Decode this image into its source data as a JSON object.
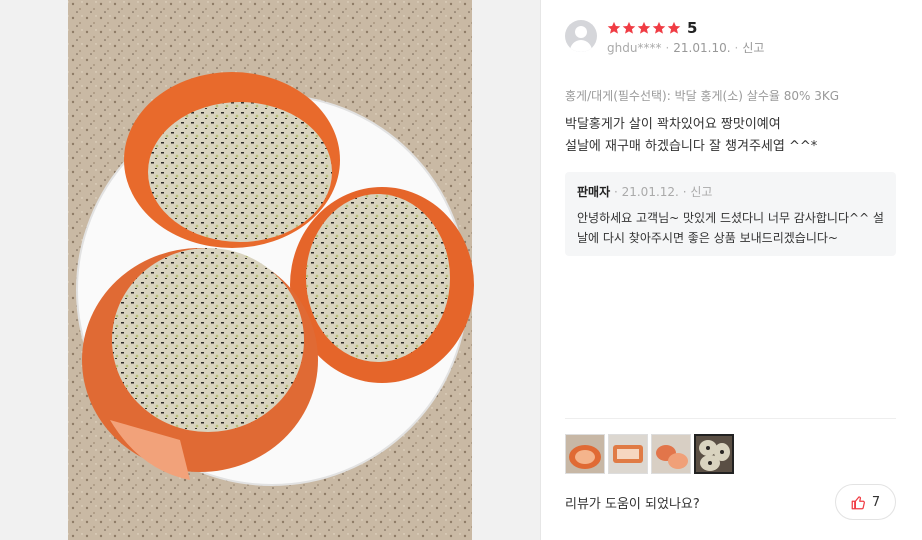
{
  "review": {
    "rating_value": "5",
    "stars_filled": 5,
    "star_color": "#f03c44",
    "user": "ghdu****",
    "date": "21.01.10.",
    "report_label": "신고",
    "option_text": "홍게/대게(필수선택): 박달 홍게(소) 살수율 80% 3KG",
    "content_line1": "박달홍게가 살이 꽉차있어요 짱맛이예여",
    "content_line2": "설날에 재구매 하겠습니다 잘 챙겨주세엽 ^^*"
  },
  "seller_reply": {
    "name": "판매자",
    "date": "21.01.12.",
    "report_label": "신고",
    "text": "안녕하세요 고객님~ 맛있게 드셨다니 너무 감사합니다^^ 설날에 다시 찾아주시면 좋은 상품 보내드리겠습니다~"
  },
  "gallery": {
    "thumb_count": 4,
    "active_index": 3
  },
  "helpful": {
    "question": "리뷰가 도움이 되었나요?",
    "count": "7"
  }
}
